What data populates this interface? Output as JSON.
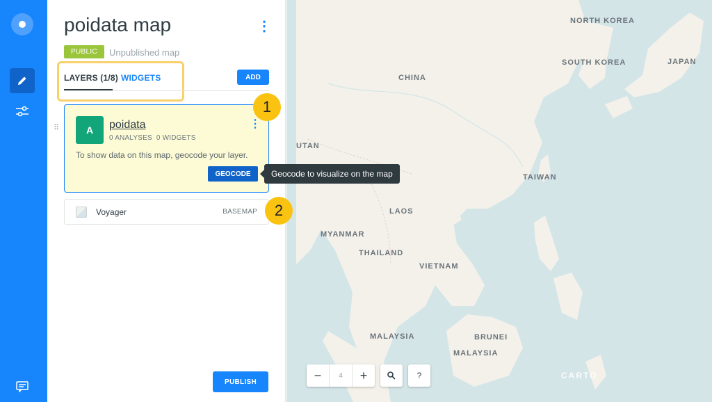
{
  "panel": {
    "title": "poidata map",
    "menu_icon": "more-vertical-icon",
    "privacy_badge": "PUBLIC",
    "publish_state": "Unpublished map"
  },
  "tabs": {
    "layers": "LAYERS (1/8)",
    "widgets": "WIDGETS",
    "add_button": "ADD"
  },
  "layer": {
    "avatar_letter": "A",
    "avatar_color": "#11a579",
    "name": "poidata",
    "analyses": "0 ANALYSES",
    "widgets": "0 WIDGETS",
    "message": "To show data on this map, geocode your layer.",
    "geocode_button": "GEOCODE"
  },
  "basemap": {
    "name": "Voyager",
    "type": "BASEMAP"
  },
  "tooltip": "Geocode to visualize on the map",
  "callouts": [
    "1",
    "2"
  ],
  "publish_button": "PUBLISH",
  "map": {
    "labels": {
      "north_korea": "NORTH KOREA",
      "south_korea": "SOUTH KOREA",
      "japan": "JAPAN",
      "china": "CHINA",
      "utan": "UTAN",
      "taiwan": "TAIWAN",
      "laos": "LAOS",
      "myanmar": "MYANMAR",
      "thailand": "THAILAND",
      "vietnam": "VIETNAM",
      "malaysia_w": "MALAYSIA",
      "brunei": "BRUNEI",
      "malaysia_e": "MALAYSIA"
    },
    "zoom_out": "−",
    "zoom_level": "4",
    "zoom_in": "+",
    "search_icon": "search-icon",
    "help": "?",
    "attribution": "CARTO"
  },
  "colors": {
    "primary": "#1785fb",
    "rail": "#1785fb",
    "public_badge": "#9bc63b",
    "callout": "#fac211",
    "layer_card_bg": "#fdfbd5",
    "sea": "#d4e5e8",
    "land": "#f3f1ea"
  }
}
